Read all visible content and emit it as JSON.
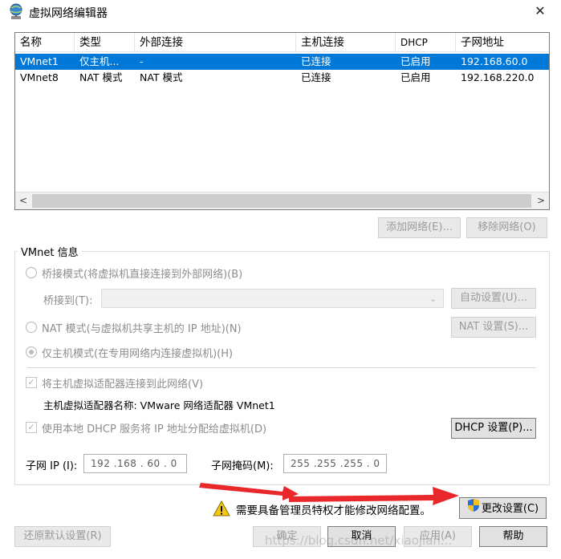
{
  "window": {
    "title": "虚拟网络编辑器",
    "close_glyph": "✕"
  },
  "list": {
    "headers": [
      "名称",
      "类型",
      "外部连接",
      "主机连接",
      "DHCP",
      "子网地址"
    ],
    "rows": [
      [
        "VMnet1",
        "仅主机...",
        "-",
        "已连接",
        "已启用",
        "192.168.60.0"
      ],
      [
        "VMnet8",
        "NAT 模式",
        "NAT 模式",
        "已连接",
        "已启用",
        "192.168.220.0"
      ]
    ],
    "selected_row": 0
  },
  "list_buttons": {
    "add": "添加网络(E)...",
    "remove": "移除网络(O)"
  },
  "vmnet_info": {
    "group_label": "VMnet 信息",
    "bridged_label": "桥接模式(将虚拟机直接连接到外部网络)(B)",
    "bridge_to_label": "桥接到(T):",
    "bridge_to_value": "",
    "auto_settings": "自动设置(U)...",
    "nat_label": "NAT 模式(与虚拟机共享主机的 IP 地址)(N)",
    "nat_settings": "NAT 设置(S)...",
    "hostonly_label": "仅主机模式(在专用网络内连接虚拟机)(H)",
    "selected_mode": "hostonly",
    "connect_adapter_label": "将主机虚拟适配器连接到此网络(V)",
    "adapter_name_label": "主机虚拟适配器名称: VMware 网络适配器 VMnet1",
    "dhcp_label": "使用本地 DHCP 服务将 IP 地址分配给虚拟机(D)",
    "dhcp_settings": "DHCP 设置(P)...",
    "subnet_ip_label": "子网 IP (I):",
    "subnet_ip_value": "192 .168 . 60  .  0",
    "subnet_mask_label": "子网掩码(M):",
    "subnet_mask_value": "255 .255 .255 .  0"
  },
  "notice": {
    "text": "需要具备管理员特权才能修改网络配置。",
    "change_settings": "更改设置(C)"
  },
  "footer": {
    "restore_defaults": "还原默认设置(R)",
    "ok": "确定",
    "cancel": "取消",
    "apply": "应用(A)",
    "help": "帮助"
  },
  "watermark": "https://blog.csdn.net/xiaojian...",
  "colors": {
    "selection": "#0078d7",
    "arrow": "#e8282b",
    "shield_blue": "#2a6fd6",
    "shield_yellow": "#f4c01c",
    "warn": "#f2c811"
  }
}
